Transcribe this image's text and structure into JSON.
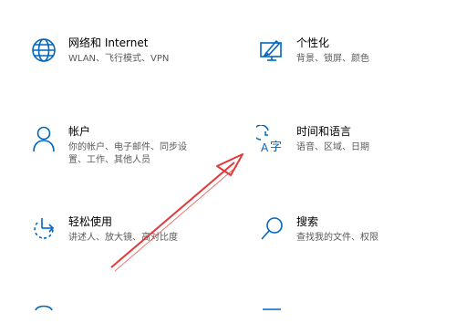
{
  "settings": {
    "tiles": [
      {
        "title": "网络和 Internet",
        "desc1": "WLAN、飞行模式、VPN",
        "desc2": "",
        "icon": "globe-icon"
      },
      {
        "title": "个性化",
        "desc1": "背景、锁屏、颜色",
        "desc2": "",
        "icon": "personalization-icon"
      },
      {
        "title": "帐户",
        "desc1": "你的帐户、电子邮件、同步设",
        "desc2": "置、工作、其他人员",
        "icon": "person-icon"
      },
      {
        "title": "时间和语言",
        "desc1": "语音、区域、日期",
        "desc2": "",
        "icon": "time-language-icon"
      },
      {
        "title": "轻松使用",
        "desc1": "讲述人、放大镜、高对比度",
        "desc2": "",
        "icon": "ease-of-access-icon"
      },
      {
        "title": "搜索",
        "desc1": "查找我的文件、权限",
        "desc2": "",
        "icon": "search-icon"
      }
    ]
  },
  "annotation": {
    "color": "#e03a3a",
    "icon": "red-arrow"
  },
  "accent_color": "#0067c0"
}
